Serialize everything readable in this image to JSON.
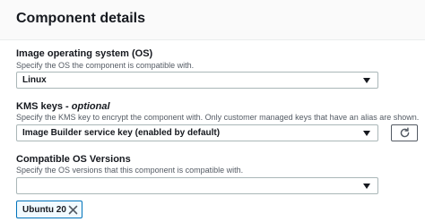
{
  "panel": {
    "title": "Component details"
  },
  "os_field": {
    "label": "Image operating system (OS)",
    "description": "Specify the OS the component is compatible with.",
    "selected": "Linux"
  },
  "kms_field": {
    "label": "KMS keys - ",
    "label_optional": "optional",
    "description": "Specify the KMS key to encrypt the component with. Only customer managed keys that have an alias are shown.",
    "selected": "Image Builder service key (enabled by default)"
  },
  "os_versions_field": {
    "label": "Compatible OS Versions",
    "description": "Specify the OS versions that this component is compatible with.",
    "selected": "",
    "tokens": [
      {
        "label": "Ubuntu 20"
      }
    ]
  },
  "icons": {
    "dropdown": "caret-down-icon",
    "refresh": "refresh-icon",
    "dismiss": "close-icon"
  }
}
